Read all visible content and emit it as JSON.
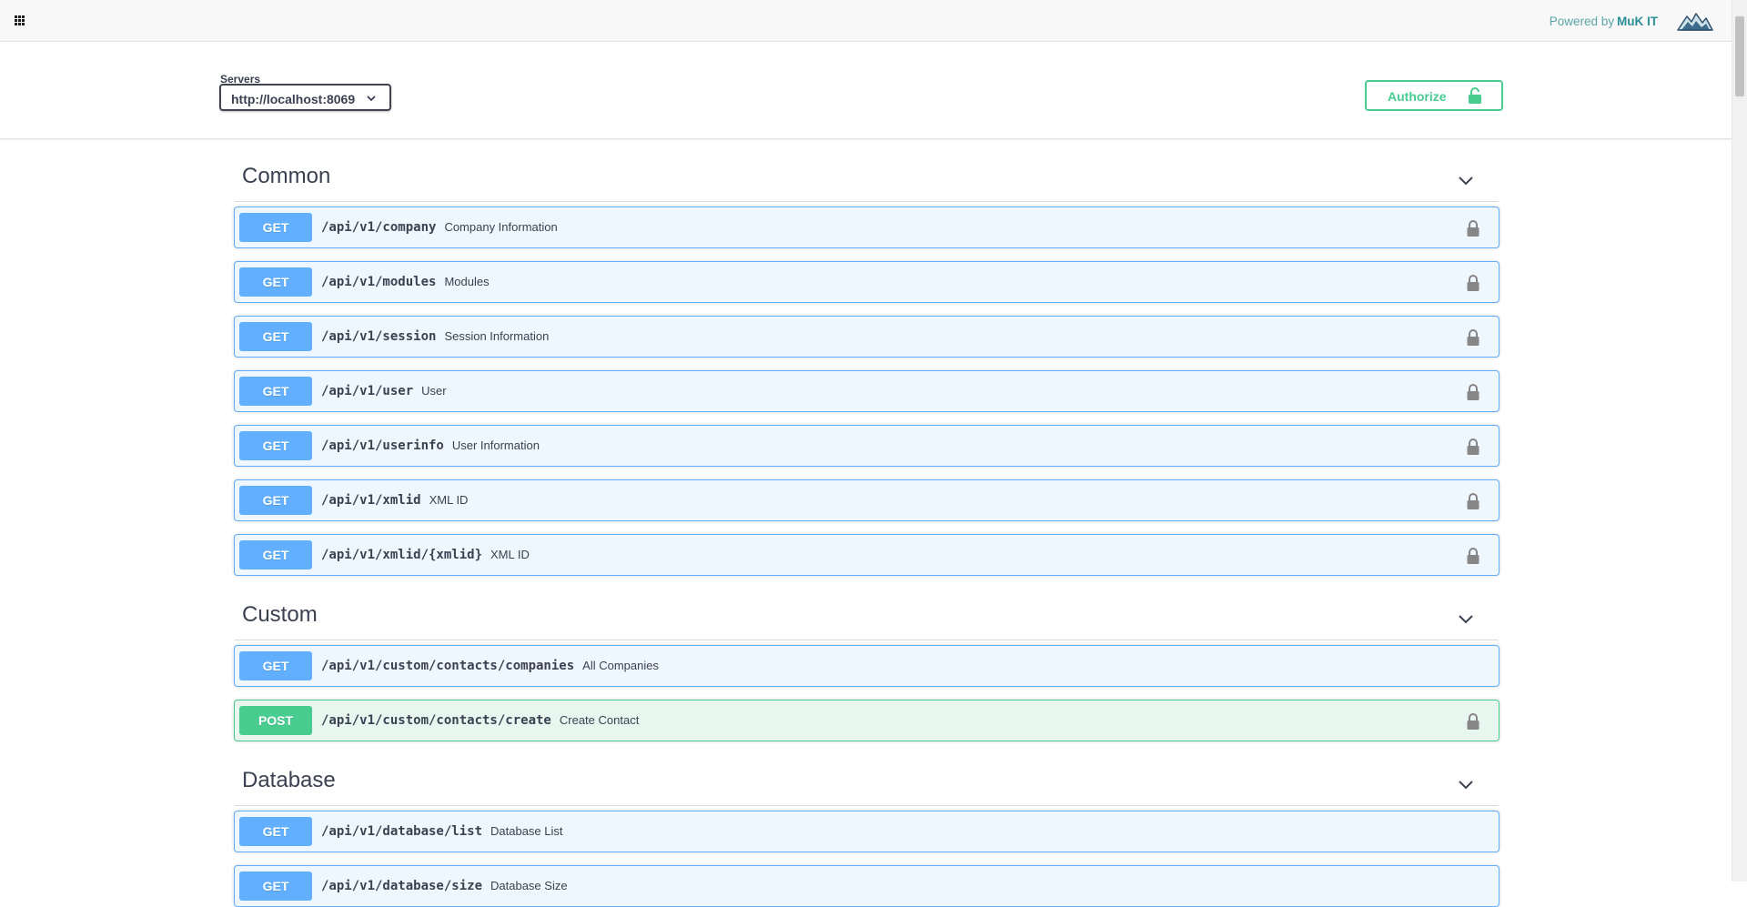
{
  "topbar": {
    "powered_by": "Powered by",
    "brand": "MuK IT"
  },
  "servers": {
    "label": "Servers",
    "selected": "http://localhost:8069"
  },
  "authorize": {
    "label": "Authorize"
  },
  "colors": {
    "get": "#61affe",
    "post": "#49cc90",
    "accent": "#2b8f97"
  },
  "sections": [
    {
      "title": "Common",
      "operations": [
        {
          "method": "GET",
          "path": "/api/v1/company",
          "summary": "Company Information",
          "locked": true
        },
        {
          "method": "GET",
          "path": "/api/v1/modules",
          "summary": "Modules",
          "locked": true
        },
        {
          "method": "GET",
          "path": "/api/v1/session",
          "summary": "Session Information",
          "locked": true
        },
        {
          "method": "GET",
          "path": "/api/v1/user",
          "summary": "User",
          "locked": true
        },
        {
          "method": "GET",
          "path": "/api/v1/userinfo",
          "summary": "User Information",
          "locked": true
        },
        {
          "method": "GET",
          "path": "/api/v1/xmlid",
          "summary": "XML ID",
          "locked": true
        },
        {
          "method": "GET",
          "path": "/api/v1/xmlid/{xmlid}",
          "summary": "XML ID",
          "locked": true
        }
      ]
    },
    {
      "title": "Custom",
      "operations": [
        {
          "method": "GET",
          "path": "/api/v1/custom/contacts/companies",
          "summary": "All Companies",
          "locked": false
        },
        {
          "method": "POST",
          "path": "/api/v1/custom/contacts/create",
          "summary": "Create Contact",
          "locked": true
        }
      ]
    },
    {
      "title": "Database",
      "operations": [
        {
          "method": "GET",
          "path": "/api/v1/database/list",
          "summary": "Database List",
          "locked": false
        },
        {
          "method": "GET",
          "path": "/api/v1/database/size",
          "summary": "Database Size",
          "locked": false
        }
      ]
    }
  ]
}
